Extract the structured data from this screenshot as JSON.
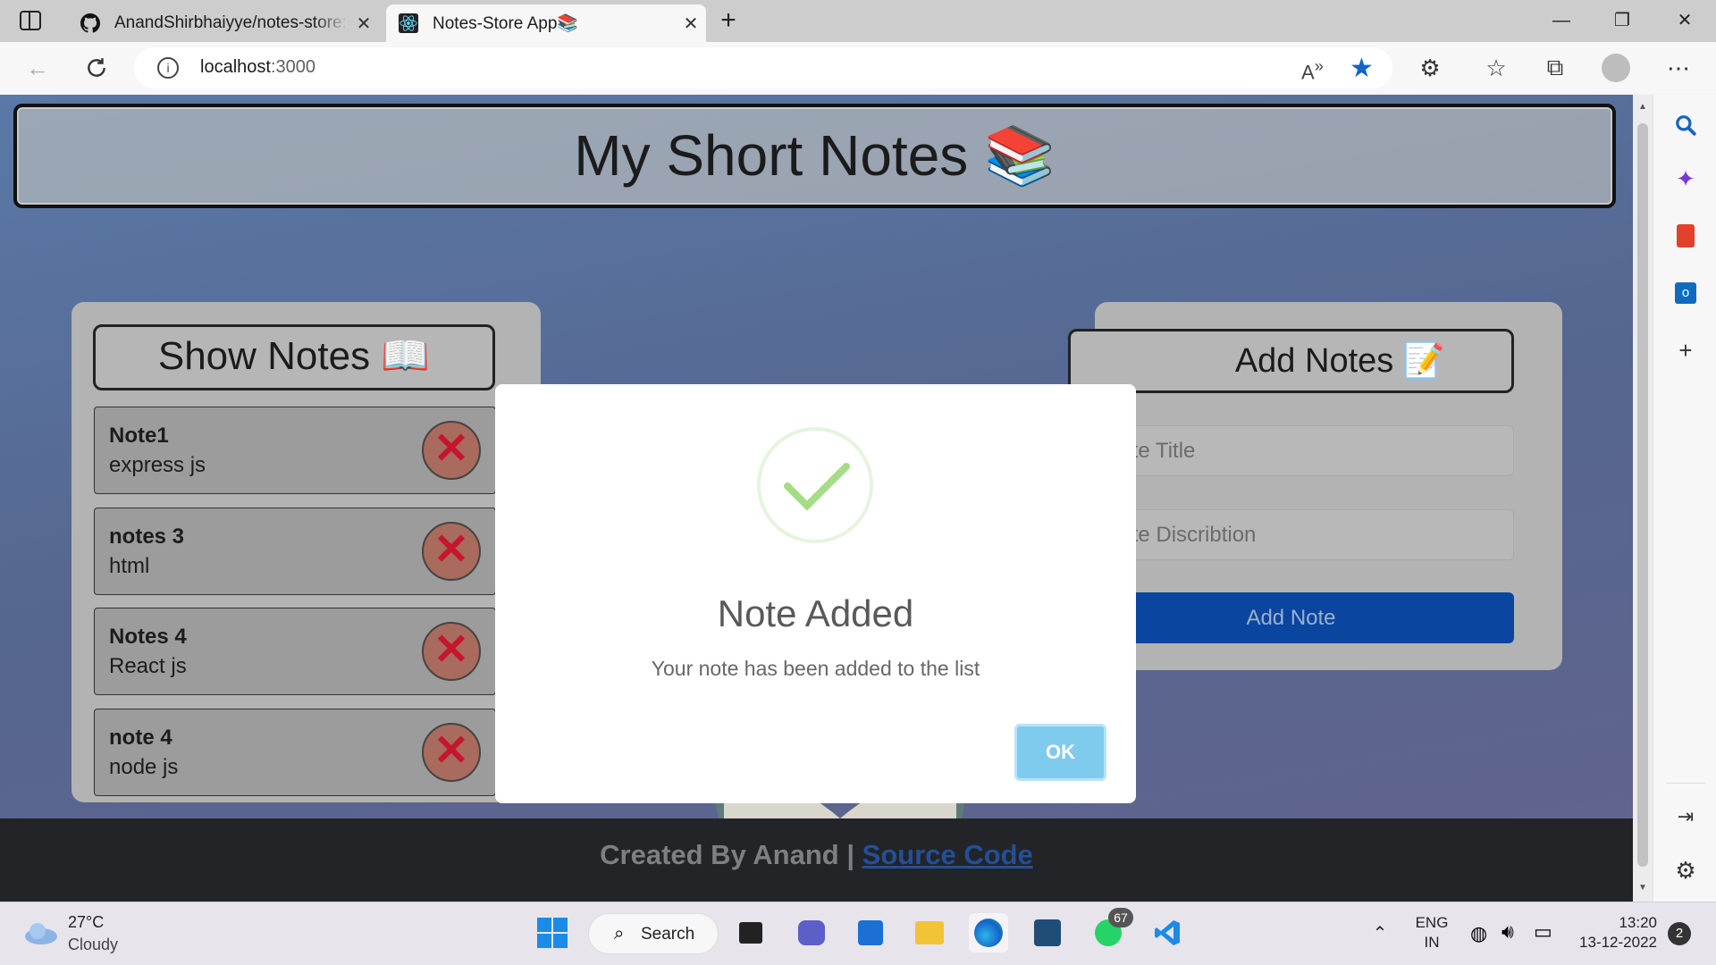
{
  "browser": {
    "tabs": [
      {
        "title": "AnandShirbhaiyye/notes-store: n",
        "icon": "github-icon"
      },
      {
        "title": "Notes-Store App📚",
        "icon": "react-icon"
      }
    ],
    "url": "localhost",
    "url_port": ":3000"
  },
  "page": {
    "title": "My Short Notes",
    "title_emoji": "📚",
    "show_notes": {
      "heading": "Show Notes",
      "heading_emoji": "📖",
      "notes": [
        {
          "title": "Note1",
          "desc": "express js"
        },
        {
          "title": "notes 3",
          "desc": "html"
        },
        {
          "title": "Notes 4",
          "desc": "React js"
        },
        {
          "title": "note 4",
          "desc": "node js"
        }
      ],
      "delete_symbol": "✕"
    },
    "add_notes": {
      "heading": "Add Notes",
      "heading_emoji": "📝",
      "title_placeholder": "Note Title",
      "desc_placeholder": "Note Discribtion",
      "button": "Add Note"
    },
    "footer": {
      "text": "Created By Anand | ",
      "link": "Source Code"
    }
  },
  "modal": {
    "title": "Note Added",
    "message": "Your note has been added to the list",
    "ok": "OK"
  },
  "taskbar": {
    "weather_temp": "27°C",
    "weather_cond": "Cloudy",
    "search": "Search",
    "whatsapp_badge": "67",
    "lang1": "ENG",
    "lang2": "IN",
    "time": "13:20",
    "date": "13-12-2022",
    "notifications": "2"
  },
  "colors": {
    "accent_blue": "#0a45a0",
    "success_green": "#a5dc86",
    "delete_red": "#c5162e"
  }
}
